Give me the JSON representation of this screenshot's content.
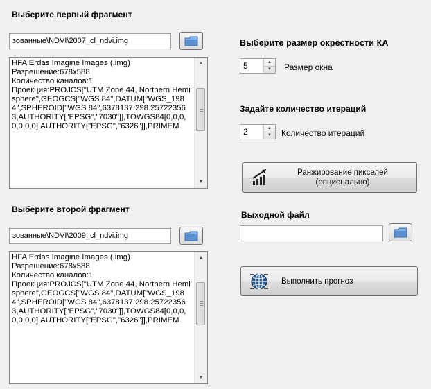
{
  "fragment1": {
    "heading": "Выберите первый фрагмент",
    "path": "зованные\\NDVI\\2007_cl_ndvi.img",
    "info": "HFA Erdas Imagine Images (.img)\nРазрешение:678x588\nКоличество каналов:1\nПроекция:PROJCS[\"UTM Zone 44, Northern Hemisphere\",GEOGCS[\"WGS 84\",DATUM[\"WGS_1984\",SPHEROID[\"WGS 84\",6378137,298.257223563,AUTHORITY[\"EPSG\",\"7030\"]],TOWGS84[0,0,0,0,0,0,0],AUTHORITY[\"EPSG\",\"6326\"]],PRIMEM"
  },
  "fragment2": {
    "heading": "Выберите второй фрагмент",
    "path": "зованные\\NDVI\\2009_cl_ndvi.img",
    "info": "HFA Erdas Imagine Images (.img)\nРазрешение:678x588\nКоличество каналов:1\nПроекция:PROJCS[\"UTM Zone 44, Northern Hemisphere\",GEOGCS[\"WGS 84\",DATUM[\"WGS_1984\",SPHEROID[\"WGS 84\",6378137,298.257223563,AUTHORITY[\"EPSG\",\"7030\"]],TOWGS84[0,0,0,0,0,0,0],AUTHORITY[\"EPSG\",\"6326\"]],PRIMEM"
  },
  "neighborhood": {
    "heading": "Выберите размер окрестности КА",
    "value": "5",
    "label": "Размер окна"
  },
  "iterations": {
    "heading": "Задайте количество итераций",
    "value": "2",
    "label": "Количество итераций"
  },
  "rank_button": {
    "label_line1": "Ранжирование пикселей",
    "label_line2": "(опционально)",
    "icon": "bar-chart-arrow-icon"
  },
  "output": {
    "heading": "Выходной файл",
    "value": ""
  },
  "forecast_button": {
    "label": "Выполнить прогноз",
    "icon": "globe-icon"
  },
  "icons": {
    "browse": "folder-icon"
  },
  "colors": {
    "window_bg": "#f0f0f0",
    "folder_blue": "#5b8fd0"
  }
}
